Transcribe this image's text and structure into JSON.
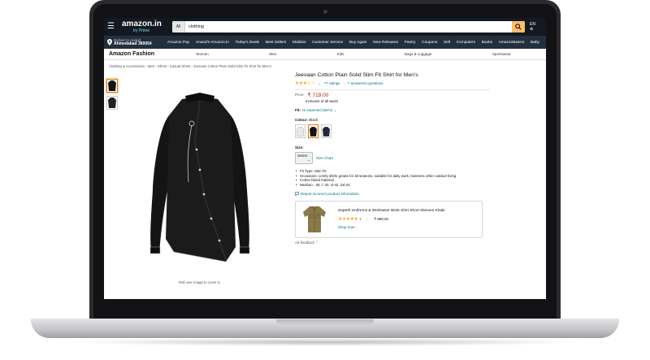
{
  "header": {
    "logo": "amazon.in",
    "logo_sub": "try Prime",
    "search_category": "All",
    "search_value": "clothing",
    "language": "EN",
    "language_sub": "⊕"
  },
  "nav": {
    "deliver_label": "Deliver to Anand",
    "deliver_location": "Ahmedabad 380054",
    "links": [
      "Amazon Pay",
      "Anand's Amazon.in",
      "Today's Deals",
      "Best Sellers",
      "Mobiles",
      "Customer Service",
      "Buy Again",
      "New Releases",
      "Pantry",
      "Coupons",
      "Sell",
      "Computers",
      "Books",
      "AmazonBasics",
      "Baby"
    ]
  },
  "fashion": {
    "title": "Amazon Fashion",
    "categories": [
      "Women",
      "Men",
      "Kids",
      "Bags & Luggage",
      "Sportswear"
    ]
  },
  "breadcrumb": "Clothing & Accessories › Men › Shirts › Casual Shirts › Jeevaan Cotton Plain Solid Slim Fit Shirt for Men's",
  "gallery": {
    "rollover": "Roll over image to zoom in"
  },
  "product": {
    "title": "Jeevaan Cotton Plain Solid Slim Fit Shirt for Men's",
    "stars": "★★★☆☆",
    "ratings": "77 ratings",
    "answered": "7 answered questions",
    "price_label": "Price:",
    "price": "₹ 719.00",
    "tax_note": "Inclusive of all taxes",
    "fit_label": "Fit:",
    "fit_value": "As expected (56%)",
    "colour_label": "Colour:",
    "colour_value": "Black",
    "size_label": "Size:",
    "size_select": "Select",
    "size_chart": "Size Chart",
    "bullets": [
      "Fit Type: Slim Fit",
      "Occasions: comfy shirts greats for all seasons, suitable for daily work, business other outdoor living",
      "Cotton blend material",
      "Medium - 38, l- 40, xl-42, 2xl-44"
    ],
    "report": "Report incorrect product information."
  },
  "ad": {
    "title": "Superb Uniforms & Workwear Work Shirt Short Sleeves Khaki",
    "stars": "★★★★★",
    "count": "1",
    "price": "₹ 999.00",
    "shop": "Shop now ›",
    "feedback": "Ad feedback"
  },
  "colors": {
    "amazon_dark": "#131921",
    "amazon_nav": "#232f3e",
    "search_button": "#febd69",
    "price_red": "#b12704",
    "link_teal": "#007185",
    "star_orange": "#ffa41c"
  }
}
